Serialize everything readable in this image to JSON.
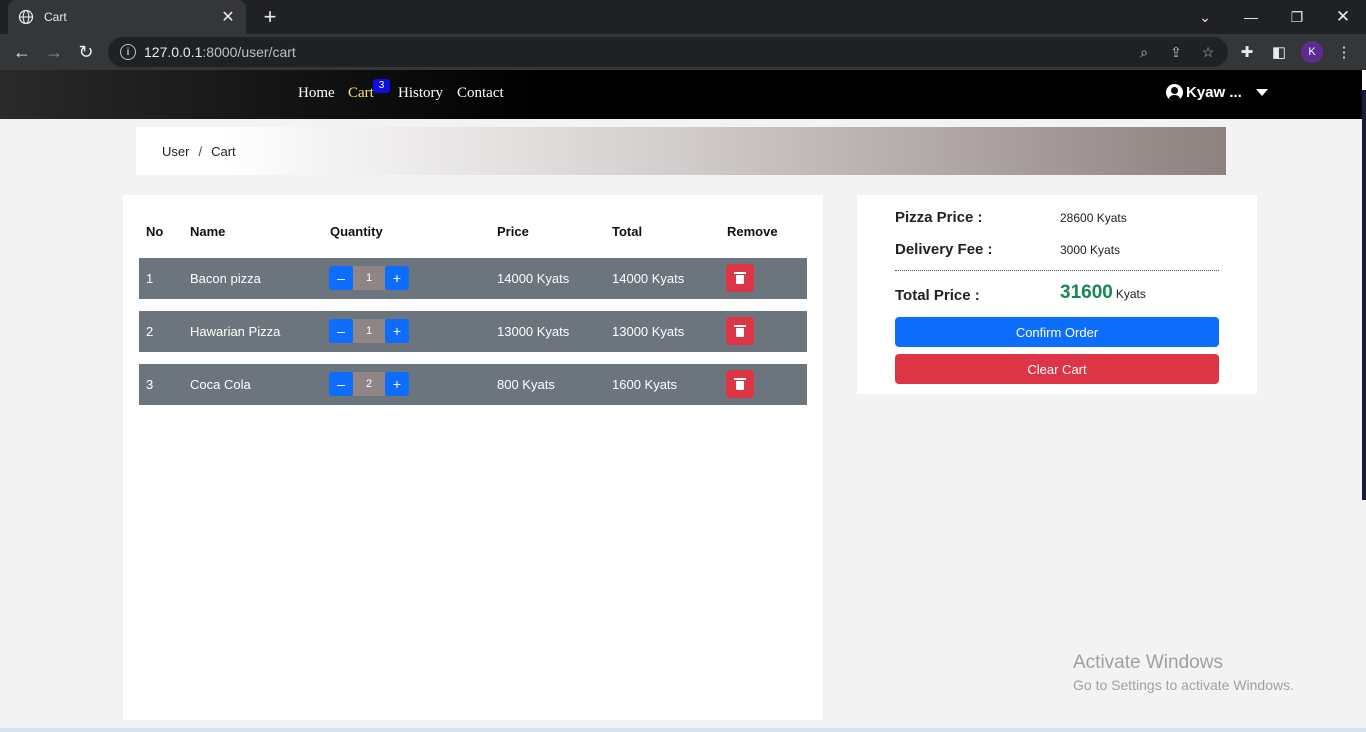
{
  "browser": {
    "tab_title": "Cart",
    "url_host": "127.0.0.1",
    "url_rest": ":8000/user/cart",
    "profile_initial": "K"
  },
  "nav": {
    "home": "Home",
    "cart": "Cart",
    "cart_badge": "3",
    "history": "History",
    "contact": "Contact",
    "user_name": "Kyaw ..."
  },
  "breadcrumb": {
    "items": [
      "User",
      "Cart"
    ],
    "separator": "/"
  },
  "table": {
    "headers": {
      "no": "No",
      "name": "Name",
      "quantity": "Quantity",
      "price": "Price",
      "total": "Total",
      "remove": "Remove"
    },
    "rows": [
      {
        "no": "1",
        "name": "Bacon pizza",
        "qty": "1",
        "price": "14000 Kyats",
        "total": "14000 Kyats"
      },
      {
        "no": "2",
        "name": "Hawarian Pizza",
        "qty": "1",
        "price": "13000 Kyats",
        "total": "13000 Kyats"
      },
      {
        "no": "3",
        "name": "Coca Cola",
        "qty": "2",
        "price": "800 Kyats",
        "total": "1600 Kyats"
      }
    ],
    "minus_symbol": "–",
    "plus_symbol": "+"
  },
  "summary": {
    "pizza_label": "Pizza Price :",
    "pizza_value": "28600 Kyats",
    "delivery_label": "Delivery Fee :",
    "delivery_value": "3000 Kyats",
    "total_label": "Total Price :",
    "total_value": "31600",
    "total_unit": "Kyats",
    "confirm_label": "Confirm Order",
    "clear_label": "Clear Cart"
  },
  "colors": {
    "primary": "#0d6efd",
    "danger": "#dc3545",
    "success": "#198754",
    "row_bg": "#6c757d",
    "active_nav": "#f7e27a"
  },
  "watermark": {
    "line1": "Activate Windows",
    "line2": "Go to Settings to activate Windows."
  }
}
